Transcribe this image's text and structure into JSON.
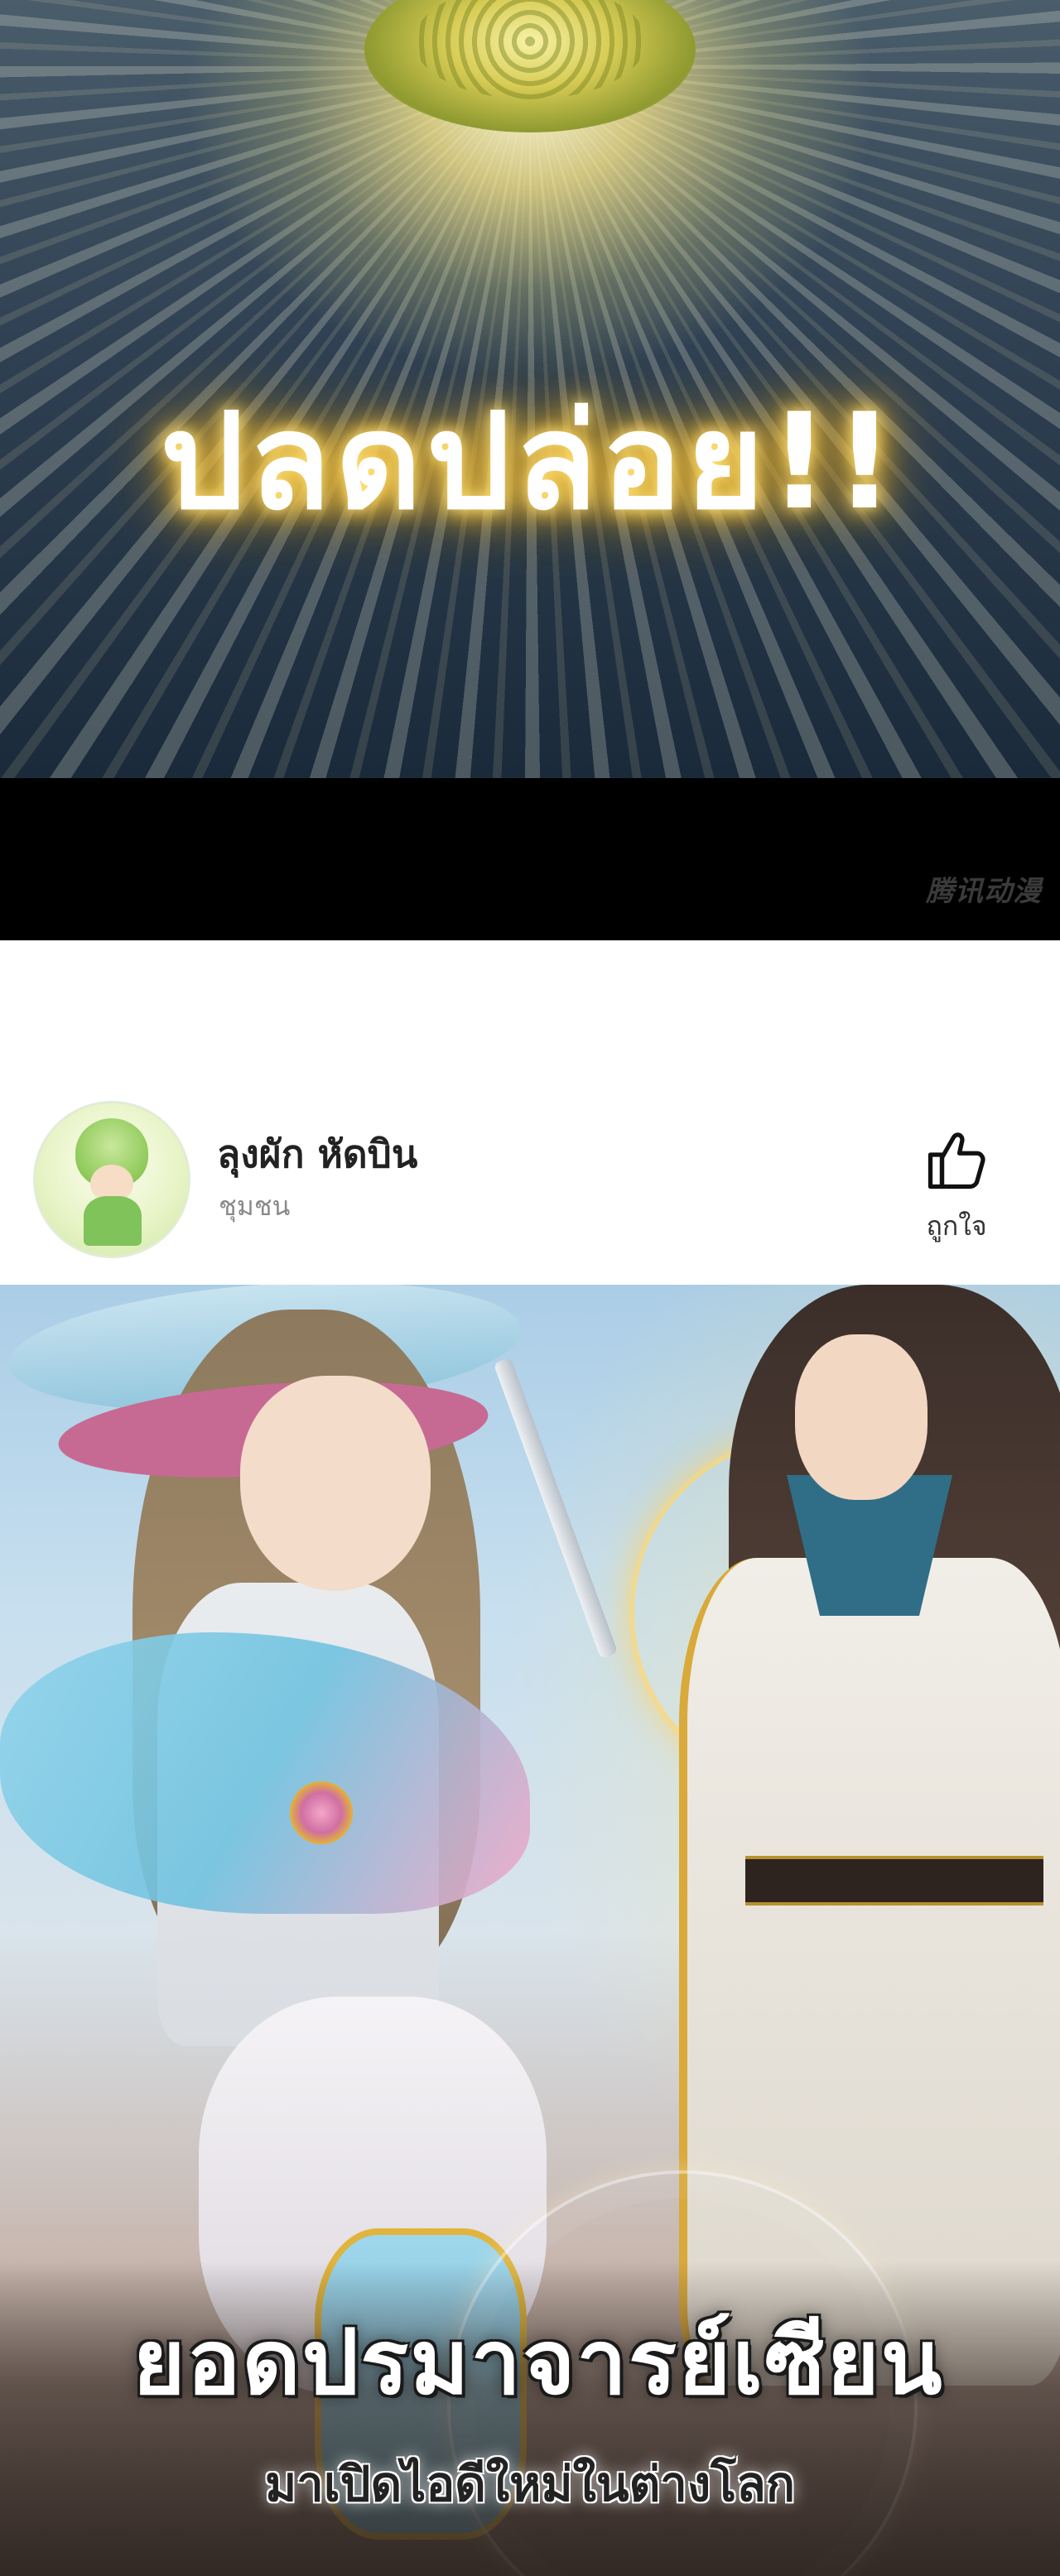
{
  "panel_burst": {
    "exclamation": "ปลดปล่อย!!"
  },
  "black_band": {
    "watermark": "腾讯动漫"
  },
  "profile": {
    "name": "ลุงผัก หัดบิน",
    "subtitle": "ชุมชน",
    "like_label": "ถูกใจ",
    "like_icon": "thumbs-up-icon",
    "avatar_icon": "cabbage-avatar"
  },
  "cover": {
    "title": "ยอดปรมาจารย์เซียน",
    "subtitle": "มาเปิดไอดีใหม่ในต่างโลก"
  },
  "colors": {
    "glow": "#ffc93a",
    "band": "#000000",
    "profile_name": "#222222",
    "profile_sub": "#8a8a8a"
  }
}
